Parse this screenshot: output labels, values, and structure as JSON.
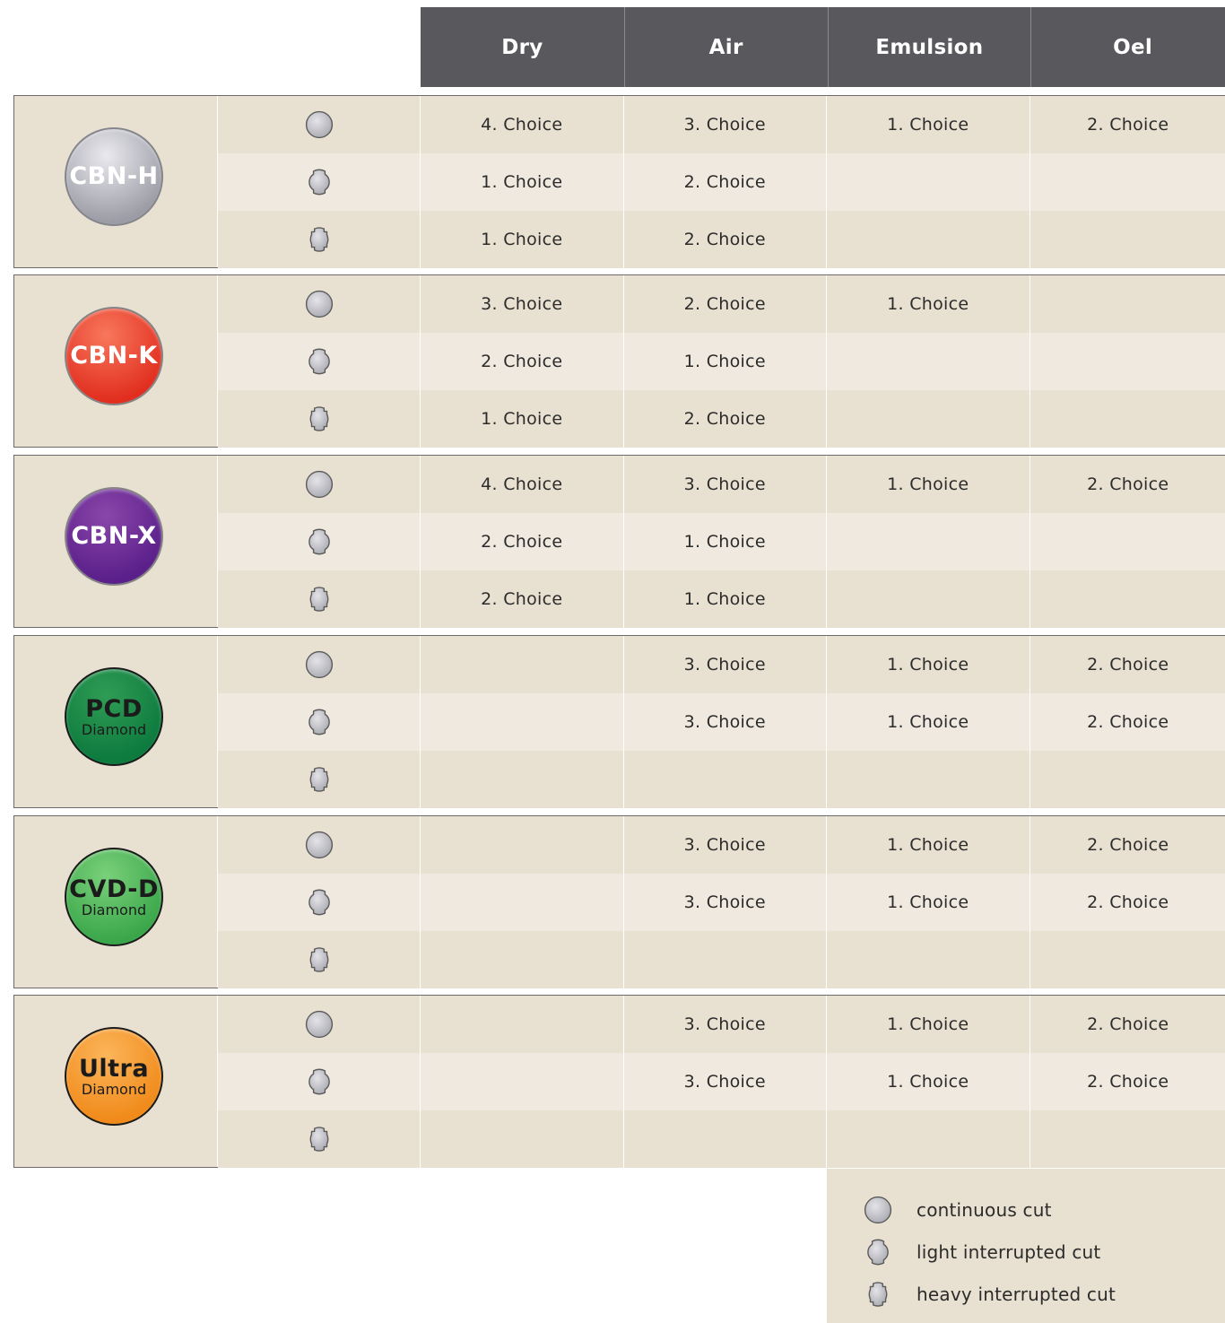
{
  "header": {
    "columns": [
      "Dry",
      "Air",
      "Emulsion",
      "Oel"
    ]
  },
  "cut_types": [
    "continuous-cut",
    "light-interrupted-cut",
    "heavy-interrupted-cut"
  ],
  "groups": [
    {
      "id": "cbn-h",
      "name": "CBN-H",
      "sub": "",
      "colors": {
        "fill_top": "#e9e9ee",
        "fill_bottom": "#9c9ca6",
        "border": "#85858c",
        "text": "#ffffff"
      },
      "rows": [
        [
          "4. Choice",
          "3. Choice",
          "1. Choice",
          "2. Choice"
        ],
        [
          "1. Choice",
          "2. Choice",
          "",
          ""
        ],
        [
          "1. Choice",
          "2. Choice",
          "",
          ""
        ]
      ]
    },
    {
      "id": "cbn-k",
      "name": "CBN-K",
      "sub": "",
      "colors": {
        "fill_top": "#f8775c",
        "fill_bottom": "#e12e1f",
        "border": "#858585",
        "text": "#ffffff"
      },
      "rows": [
        [
          "3. Choice",
          "2. Choice",
          "1. Choice",
          ""
        ],
        [
          "2. Choice",
          "1. Choice",
          "",
          ""
        ],
        [
          "1. Choice",
          "2. Choice",
          "",
          ""
        ]
      ]
    },
    {
      "id": "cbn-x",
      "name": "CBN-X",
      "sub": "",
      "colors": {
        "fill_top": "#8a46aa",
        "fill_bottom": "#5a1f8a",
        "border": "#858585",
        "text": "#ffffff"
      },
      "rows": [
        [
          "4. Choice",
          "3. Choice",
          "1. Choice",
          "2. Choice"
        ],
        [
          "2. Choice",
          "1. Choice",
          "",
          ""
        ],
        [
          "2. Choice",
          "1. Choice",
          "",
          ""
        ]
      ]
    },
    {
      "id": "pcd",
      "name": "PCD",
      "sub": "Diamond",
      "colors": {
        "fill_top": "#2f9c55",
        "fill_bottom": "#0d7a3e",
        "border": "#1b1b1b",
        "text": "#1b1b1b"
      },
      "rows": [
        [
          "",
          "3. Choice",
          "1. Choice",
          "2. Choice"
        ],
        [
          "",
          "3. Choice",
          "1. Choice",
          "2. Choice"
        ],
        [
          "",
          "",
          "",
          ""
        ]
      ]
    },
    {
      "id": "cvd-d",
      "name": "CVD-D",
      "sub": "Diamond",
      "colors": {
        "fill_top": "#7ad17a",
        "fill_bottom": "#3aa64a",
        "border": "#1b1b1b",
        "text": "#1b1b1b"
      },
      "rows": [
        [
          "",
          "3. Choice",
          "1. Choice",
          "2. Choice"
        ],
        [
          "",
          "3. Choice",
          "1. Choice",
          "2. Choice"
        ],
        [
          "",
          "",
          "",
          ""
        ]
      ]
    },
    {
      "id": "ultra",
      "name": "Ultra",
      "sub": "Diamond",
      "colors": {
        "fill_top": "#fcb55a",
        "fill_bottom": "#f08a1a",
        "border": "#1b1b1b",
        "text": "#1b1b1b"
      },
      "rows": [
        [
          "",
          "3. Choice",
          "1. Choice",
          "2. Choice"
        ],
        [
          "",
          "3. Choice",
          "1. Choice",
          "2. Choice"
        ],
        [
          "",
          "",
          "",
          ""
        ]
      ]
    }
  ],
  "legend": [
    {
      "icon": "continuous-cut-icon",
      "label": "continuous cut"
    },
    {
      "icon": "light-interrupted-cut-icon",
      "label": "light interrupted cut"
    },
    {
      "icon": "heavy-interrupted-cut-icon",
      "label": "heavy interrupted cut"
    }
  ]
}
